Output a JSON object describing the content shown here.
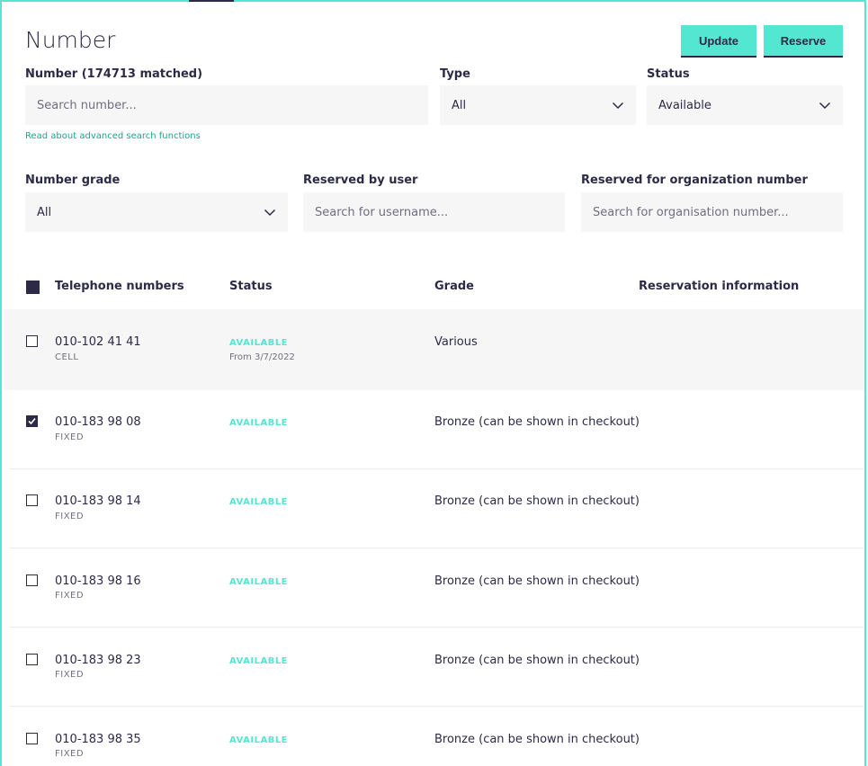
{
  "page": {
    "title": "Number"
  },
  "actions": {
    "update_label": "Update",
    "reserve_label": "Reserve"
  },
  "filters": {
    "number_label": "Number (174713 matched)",
    "number_placeholder": "Search number...",
    "advanced_link": "Read about advanced search functions",
    "type_label": "Type",
    "type_value": "All",
    "status_label": "Status",
    "status_value": "Available",
    "grade_label": "Number grade",
    "grade_value": "All",
    "reserved_user_label": "Reserved by user",
    "reserved_user_placeholder": "Search for username...",
    "reserved_org_label": "Reserved for organization number",
    "reserved_org_placeholder": "Search for organisation number..."
  },
  "table": {
    "headers": [
      "Telephone numbers",
      "Status",
      "Grade",
      "Reservation information"
    ],
    "rows": [
      {
        "number": "010-102 41 41",
        "type": "CELL",
        "status": "AVAILABLE",
        "from": "From 3/7/2022",
        "grade": "Various",
        "checked": false
      },
      {
        "number": "010-183 98 08",
        "type": "FIXED",
        "status": "AVAILABLE",
        "from": "",
        "grade": "Bronze (can be shown in checkout)",
        "checked": true
      },
      {
        "number": "010-183 98 14",
        "type": "FIXED",
        "status": "AVAILABLE",
        "from": "",
        "grade": "Bronze (can be shown in checkout)",
        "checked": false
      },
      {
        "number": "010-183 98 16",
        "type": "FIXED",
        "status": "AVAILABLE",
        "from": "",
        "grade": "Bronze (can be shown in checkout)",
        "checked": false
      },
      {
        "number": "010-183 98 23",
        "type": "FIXED",
        "status": "AVAILABLE",
        "from": "",
        "grade": "Bronze (can be shown in checkout)",
        "checked": false
      },
      {
        "number": "010-183 98 35",
        "type": "FIXED",
        "status": "AVAILABLE",
        "from": "",
        "grade": "Bronze (can be shown in checkout)",
        "checked": false
      }
    ]
  },
  "colors": {
    "accent": "#53e6d1",
    "navy": "#2c2b47",
    "field_bg": "#f6f6f6",
    "link": "#19a68f"
  }
}
